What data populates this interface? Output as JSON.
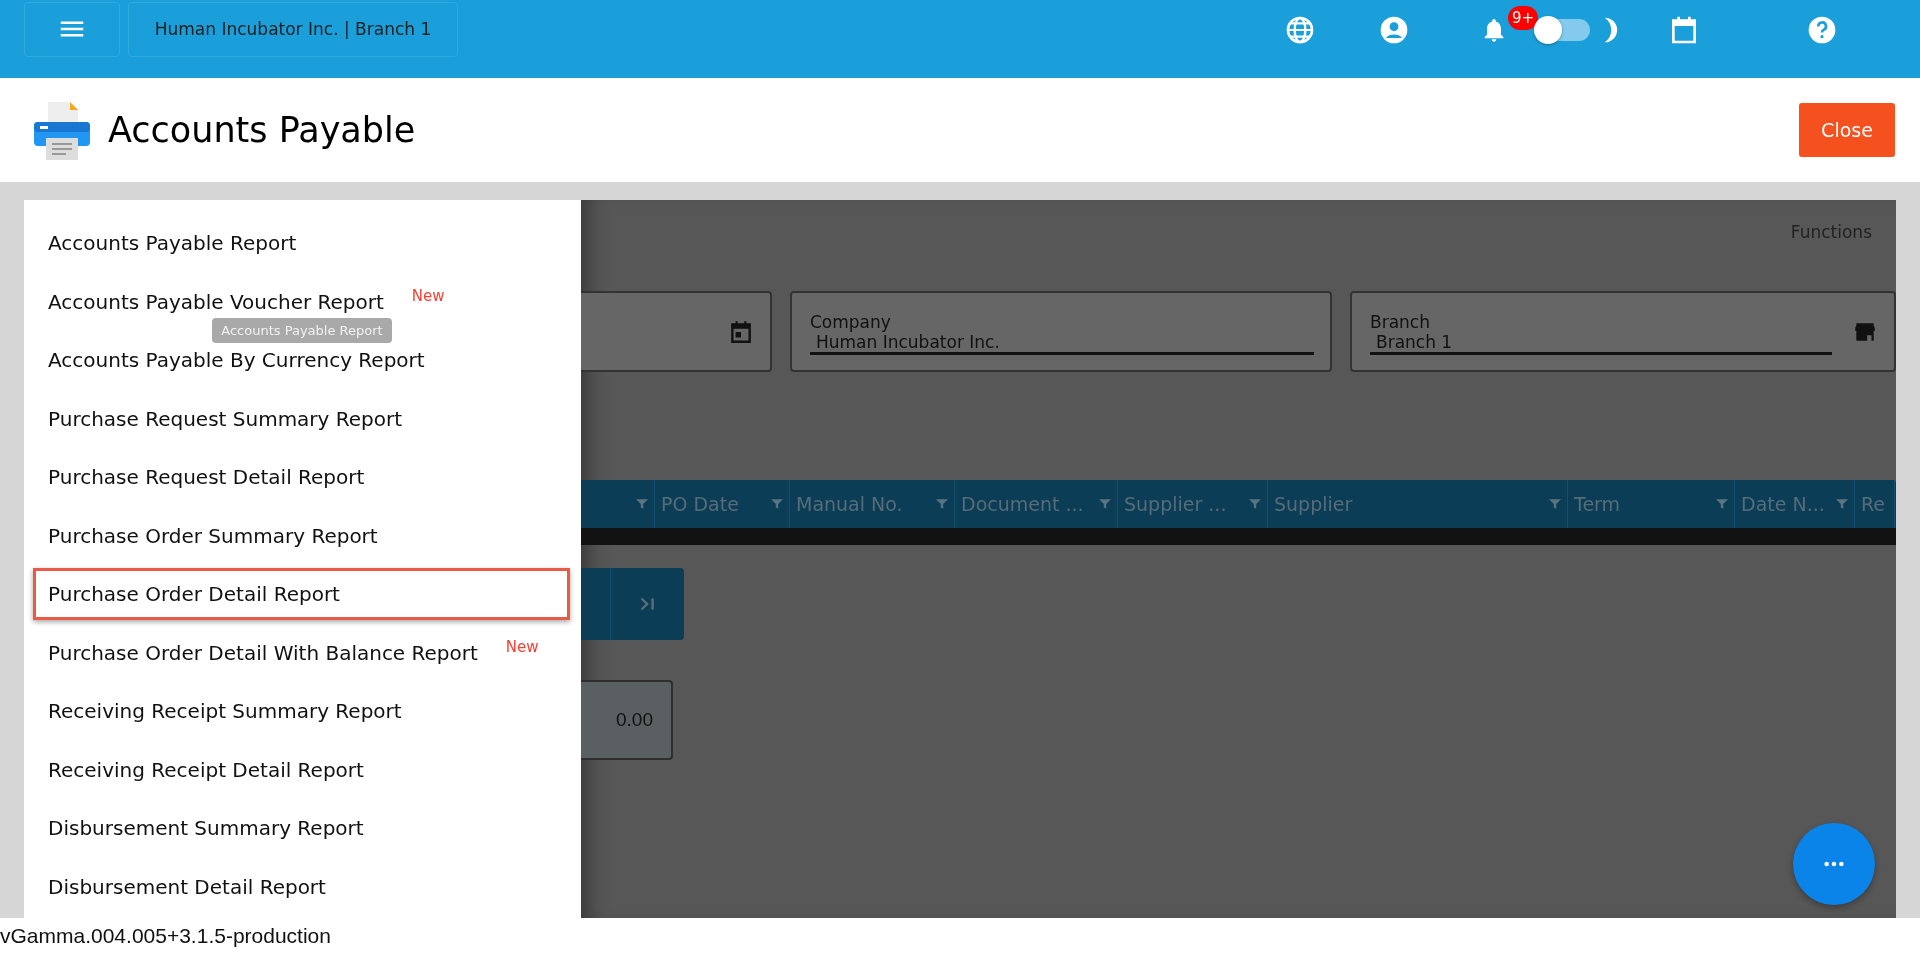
{
  "top_bar": {
    "branch_label": "Human Incubator Inc. | Branch 1",
    "notification_badge": "9+",
    "dark_mode_on": false
  },
  "header": {
    "title": "Accounts Payable",
    "close_button": "Close"
  },
  "report_menu": {
    "tooltip": "Accounts Payable Report",
    "items": [
      {
        "label": "Accounts Payable Report",
        "selected": false
      },
      {
        "label": "Accounts Payable Voucher Report",
        "selected": false,
        "badge": "New"
      },
      {
        "label": "Accounts Payable By Currency Report",
        "selected": false
      },
      {
        "label": "Purchase Request Summary Report",
        "selected": false
      },
      {
        "label": "Purchase Request Detail Report",
        "selected": false
      },
      {
        "label": "Purchase Order Summary Report",
        "selected": false
      },
      {
        "label": "Purchase Order Detail Report",
        "selected": true
      },
      {
        "label": "Purchase Order Detail With Balance Report",
        "selected": false,
        "badge": "New"
      },
      {
        "label": "Receiving Receipt Summary Report",
        "selected": false
      },
      {
        "label": "Receiving Receipt Detail Report",
        "selected": false
      },
      {
        "label": "Disbursement Summary Report",
        "selected": false
      },
      {
        "label": "Disbursement Detail Report",
        "selected": false
      }
    ]
  },
  "content": {
    "functions_label": "Functions",
    "fields": [
      {
        "kind": "date"
      },
      {
        "kind": "text",
        "label": "Company",
        "value": "Human Incubator Inc."
      },
      {
        "kind": "store",
        "label": "Branch",
        "value": "Branch 1"
      }
    ],
    "grid_columns": [
      "PO Date",
      "Manual No.",
      "Document ...",
      "Supplier ...",
      "Supplier",
      "Term",
      "Date N...",
      "Re"
    ],
    "total": "0.00"
  },
  "version": "vGamma.004.005+3.1.5-production"
}
